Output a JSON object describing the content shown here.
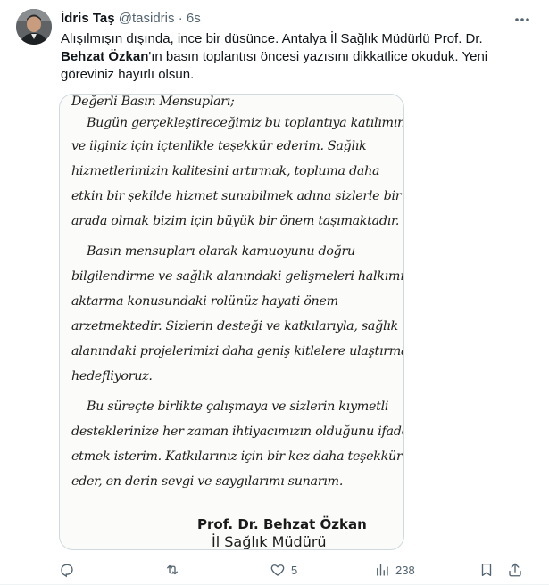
{
  "author": {
    "name": "İdris Taş",
    "handle": "@tasidris",
    "separator": "·",
    "time": "6s"
  },
  "tweet": {
    "text_part1": "Alışılmışın dışında, ince bir düsünce. Antalya İl Sağlık Müdürlü Prof. Dr.",
    "text_bold": "Behzat Özkan",
    "text_part2": "'ın basın toplantısı öncesi yazısını dikkatlice okuduk. Yeni göreviniz hayırlı olsun."
  },
  "document": {
    "lines": [
      "Değerli Basın Mensupları;",
      "    Bugün gerçekleştireceğimiz bu toplantıya katılımınız",
      "ve ilginiz için içtenlikle teşekkür ederim. Sağlık",
      "hizmetlerimizin kalitesini artırmak, topluma daha",
      "etkin bir şekilde hizmet sunabilmek adına sizlerle bir",
      "arada olmak bizim için büyük bir önem taşımaktadır.",
      "    Basın mensupları olarak kamuoyunu doğru",
      "bilgilendirme ve sağlık alanındaki gelişmeleri halkımıza",
      "aktarma konusundaki rolünüz hayati önem",
      "arzetmektedir. Sizlerin desteği ve katkılarıyla, sağlık",
      "alanındaki projelerimizi daha geniş kitlelere ulaştırmayı",
      "hedefliyoruz.",
      "    Bu süreçte birlikte çalışmaya ve sizlerin kıymetli",
      "desteklerinize her zaman ihtiyacımızın olduğunu ifade",
      "etmek isterim. Katkılarınız için bir kez daha teşekkür",
      "eder, en derin sevgi ve saygılarımı sunarım."
    ],
    "signature_name": "Prof. Dr. Behzat Özkan",
    "signature_title": "İl Sağlık Müdürü"
  },
  "actions": {
    "reply_count": "",
    "retweet_count": "",
    "like_count": "5",
    "views_count": "238"
  }
}
